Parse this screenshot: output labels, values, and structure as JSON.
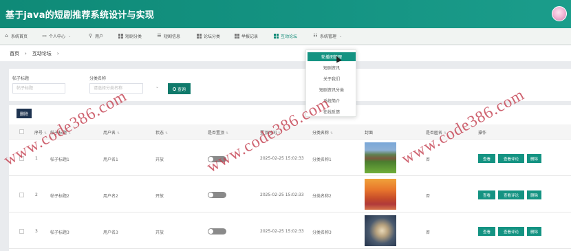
{
  "header": {
    "title": "基于java的短剧推荐系统设计与实现"
  },
  "topnav": {
    "items": [
      {
        "label": "系统首页",
        "icon": "home-icon"
      },
      {
        "label": "个人中心",
        "icon": "user-card-icon",
        "has_dropdown": true
      },
      {
        "label": "用户",
        "icon": "person-icon"
      },
      {
        "label": "短剧分类",
        "icon": "grid-icon"
      },
      {
        "label": "短剧信息",
        "icon": "list-icon"
      },
      {
        "label": "论坛分类",
        "icon": "grid-icon"
      },
      {
        "label": "举报记录",
        "icon": "grid-icon"
      },
      {
        "label": "互动论坛",
        "icon": "grid-icon",
        "active": true
      },
      {
        "label": "系统管理",
        "icon": "settings-list-icon",
        "has_dropdown": true
      }
    ],
    "active_color": "#0f8a77"
  },
  "breadcrumb": {
    "home": "首页",
    "current": "互动论坛"
  },
  "search": {
    "title_label": "帖子标题",
    "title_placeholder": "帖子标题",
    "category_label": "分类名称",
    "category_placeholder": "请选择分类名称",
    "query_label": "查询"
  },
  "table": {
    "delete_label": "删除",
    "columns": [
      "序号",
      "帖子标题",
      "用户名",
      "状态",
      "是否置顶",
      "置顶时间",
      "分类名称",
      "封面",
      "是否匿名",
      "操作"
    ],
    "rows": [
      {
        "index": "1",
        "title": "帖子标题1",
        "username": "用户名1",
        "status": "开放",
        "pinned": false,
        "pinned_time": "2025-02-25 15:02:33",
        "category": "分类名称1",
        "anonymous": "否",
        "image": "campus-garden"
      },
      {
        "index": "2",
        "title": "帖子标题2",
        "username": "用户名2",
        "status": "开放",
        "pinned": false,
        "pinned_time": "2025-02-25 15:02:33",
        "category": "分类名称2",
        "anonymous": "否",
        "image": "autumn-steps"
      },
      {
        "index": "3",
        "title": "帖子标题3",
        "username": "用户名3",
        "status": "开放",
        "pinned": false,
        "pinned_time": "2025-02-25 15:02:33",
        "category": "分类名称3",
        "anonymous": "否",
        "image": "fantasy-beast"
      }
    ],
    "actions": {
      "view": "查看",
      "view_comments": "查看评论",
      "delete": "删除"
    }
  },
  "dropdown": {
    "items": [
      "轮播图管理",
      "短剧资讯",
      "关于我们",
      "短剧资讯分类",
      "系统简介",
      "在线反馈"
    ],
    "highlighted_index": 0
  },
  "watermark": {
    "text": "www.code386.com"
  }
}
